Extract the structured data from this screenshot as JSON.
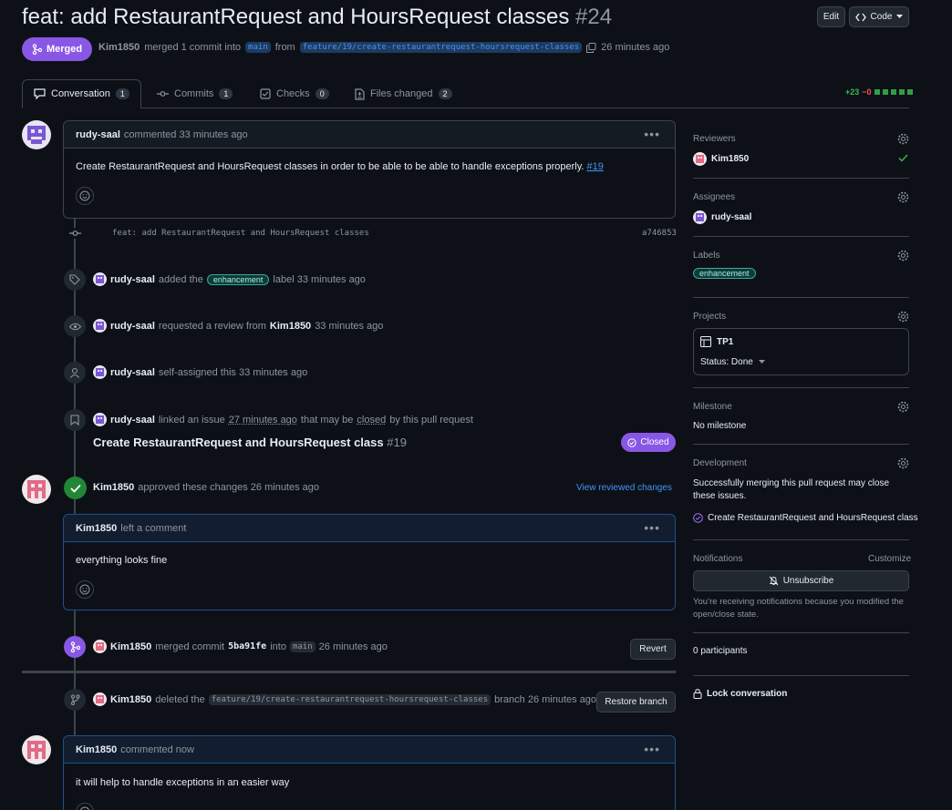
{
  "header": {
    "title": "feat: add RestaurantRequest and HoursRequest classes",
    "number": "#24",
    "edit_label": "Edit",
    "code_label": "Code",
    "status": "Merged",
    "merger": "Kim1850",
    "merge_text": "merged 1 commit into",
    "base_branch": "main",
    "from_text": "from",
    "head_branch": "feature/19/create-restaurantrequest-hoursrequest-classes",
    "time": "26 minutes ago"
  },
  "tabs": [
    {
      "label": "Conversation",
      "count": "1"
    },
    {
      "label": "Commits",
      "count": "1"
    },
    {
      "label": "Checks",
      "count": "0"
    },
    {
      "label": "Files changed",
      "count": "2"
    }
  ],
  "diffstat": {
    "additions": "+23",
    "deletions": "−0"
  },
  "timeline": {
    "comment1": {
      "author": "rudy-saal",
      "meta": "commented 33 minutes ago",
      "body": "Create RestaurantRequest and HoursRequest classes in order to be able to be able to handle exceptions properly.",
      "issue_ref": "#19"
    },
    "commit": {
      "message": "feat: add RestaurantRequest and HoursRequest classes",
      "sha": "a746853"
    },
    "label_event": {
      "actor": "rudy-saal",
      "pre": "added the",
      "label": "enhancement",
      "post": "label 33 minutes ago"
    },
    "review_request_event": {
      "actor": "rudy-saal",
      "pre": "requested a review from",
      "target": "Kim1850",
      "post": "33 minutes ago"
    },
    "assign_event": {
      "actor": "rudy-saal",
      "text": "self-assigned this 33 minutes ago"
    },
    "link_event": {
      "actor": "rudy-saal",
      "pre": "linked an issue",
      "time": "27 minutes ago",
      "mid": "that may be",
      "closed_word": "closed",
      "post": "by this pull request",
      "issue_title": "Create RestaurantRequest and HoursRequest class",
      "issue_number": "#19",
      "issue_state": "Closed"
    },
    "review": {
      "author": "Kim1850",
      "meta": "approved these changes 26 minutes ago",
      "view_changes": "View reviewed changes",
      "comment_author": "Kim1850",
      "comment_meta": "left a comment",
      "comment_body": "everything looks fine"
    },
    "merge_event": {
      "actor": "Kim1850",
      "pre": "merged commit",
      "sha": "5ba91fe",
      "into": "into",
      "branch": "main",
      "time": "26 minutes ago",
      "revert_label": "Revert"
    },
    "delete_event": {
      "actor": "Kim1850",
      "pre": "deleted the",
      "branch": "feature/19/create-restaurantrequest-hoursrequest-classes",
      "post": "branch 26 minutes ago",
      "restore_label": "Restore branch"
    },
    "comment2": {
      "author": "Kim1850",
      "meta": "commented now",
      "body": "it will help to handle exceptions in an easier way"
    }
  },
  "sidebar": {
    "reviewers": {
      "title": "Reviewers",
      "user": "Kim1850"
    },
    "assignees": {
      "title": "Assignees",
      "user": "rudy-saal"
    },
    "labels": {
      "title": "Labels",
      "label": "enhancement"
    },
    "projects": {
      "title": "Projects",
      "project": "TP1",
      "status": "Status: Done"
    },
    "milestone": {
      "title": "Milestone",
      "value": "No milestone"
    },
    "development": {
      "title": "Development",
      "text": "Successfully merging this pull request may close these issues.",
      "issue": "Create RestaurantRequest and HoursRequest class"
    },
    "notifications": {
      "title": "Notifications",
      "customize": "Customize",
      "button": "Unsubscribe",
      "reason": "You’re receiving notifications because you modified the open/close state."
    },
    "participants": "0 participants",
    "lock": "Lock conversation"
  },
  "colors": {
    "merged": "#8957e5",
    "link": "#4493f8",
    "success": "#238636",
    "label_bg": "#0f3b39"
  }
}
